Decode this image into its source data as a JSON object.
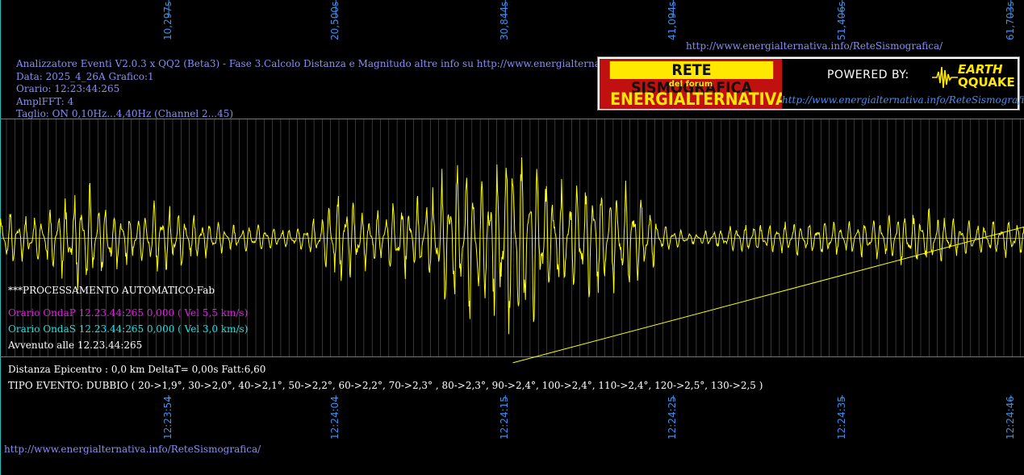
{
  "top_url": "http://www.energialternativa.info/ReteSismografica/",
  "bottom_url": "http://www.energialternativa.info/ReteSismografica/",
  "info_lines": [
    "Analizzatore Eventi V2.0.3 x QQ2 (Beta3) - Fase 3.Calcolo Distanza e Magnitudo altre info su http://www.energialternativa.info/ReteSism",
    "Data: 2025_4_26A Grafico:1",
    "Orario: 12:23:44:265",
    "AmplFFT: 4",
    "Taglio: ON 0,10Hz...4,40Hz       (Channel 2...45)"
  ],
  "banner": {
    "logo_top": "RETE SISMOGRAFICA",
    "logo_mid": "del forum",
    "logo_bottom": "ENERGIALTERNATIVA",
    "powered_by": "POWERED BY:",
    "brand_earth": "EARTH",
    "brand_quake": "QQUAKE",
    "url": "http://www.energialternativa.info/ReteSismografica"
  },
  "overlay": {
    "processing": "***PROCESSAMENTO AUTOMATICO:Fab",
    "wave_p": "Orario OndaP 12.23.44:265  0,000 ( Vel 5,5 km/s)",
    "wave_s": "Orario OndaS 12.23.44:265  0,000 ( Vel 3,0 km/s)",
    "happened": "Avvenuto alle 12.23.44:265",
    "distance": "Distanza Epicentro : 0,0 km DeltaT= 0,00s  Fatt:6,60",
    "event_type": "TIPO EVENTO: DUBBIO ( 20->1,9°, 30->2,0°, 40->2,1°, 50->2,2°, 60->2,2°, 70->2,3° , 80->2,3°, 90->2,4°, 100->2,4°, 110->2,4°, 120->2,5°, 130->2,5 )"
  },
  "colors": {
    "background": "#000000",
    "signal": "#ffff00",
    "grid": "#5a5a5a",
    "info_text": "#8a8ef0",
    "tick_text": "#3f8fe8",
    "wave_p": "#e020e0",
    "wave_s": "#20e0e0",
    "white_text": "#ffffff",
    "edge_line": "#20c0c0"
  },
  "chart_data": {
    "type": "line",
    "title": "",
    "xlabel": "",
    "ylabel": "",
    "grid": true,
    "top_ticks": [
      "10,297s",
      "20,500s",
      "30,844s",
      "41,094s",
      "51,406s",
      "61,703s"
    ],
    "top_tick_values": [
      10.297,
      20.5,
      30.844,
      41.094,
      51.406,
      61.703
    ],
    "bottom_ticks": [
      "12:23:54",
      "12:24:04",
      "12:24:15",
      "12:24:25",
      "12:24:35",
      "12:24:46"
    ],
    "bottom_tick_values": [
      10.297,
      20.5,
      30.844,
      41.094,
      51.406,
      61.703
    ],
    "xlim": [
      0,
      62.5
    ],
    "ylim": [
      -1,
      1
    ],
    "series": [
      {
        "envelope": {
          "x": [
            0,
            2,
            4,
            5,
            6,
            7.5,
            8.5,
            9.5,
            11,
            12,
            13,
            14.5,
            16,
            18,
            19.5,
            20.5,
            21.5,
            22.5,
            24,
            25.5,
            27,
            28.5,
            29.5,
            30.5,
            31.3,
            32,
            33,
            34,
            35,
            36,
            37,
            38.5,
            39.5,
            40.5,
            42,
            43,
            44,
            46,
            48,
            50,
            52,
            54,
            55.5,
            57,
            58.5,
            60,
            61.5,
            62.5
          ],
          "amp": [
            0.25,
            0.18,
            0.35,
            0.45,
            0.38,
            0.25,
            0.2,
            0.3,
            0.25,
            0.18,
            0.15,
            0.1,
            0.12,
            0.08,
            0.18,
            0.45,
            0.35,
            0.22,
            0.3,
            0.35,
            0.55,
            0.7,
            0.58,
            0.75,
            0.98,
            0.8,
            0.62,
            0.5,
            0.45,
            0.55,
            0.5,
            0.45,
            0.32,
            0.12,
            0.05,
            0.06,
            0.1,
            0.14,
            0.14,
            0.16,
            0.14,
            0.18,
            0.24,
            0.22,
            0.16,
            0.14,
            0.16,
            0.14
          ]
        }
      }
    ]
  }
}
